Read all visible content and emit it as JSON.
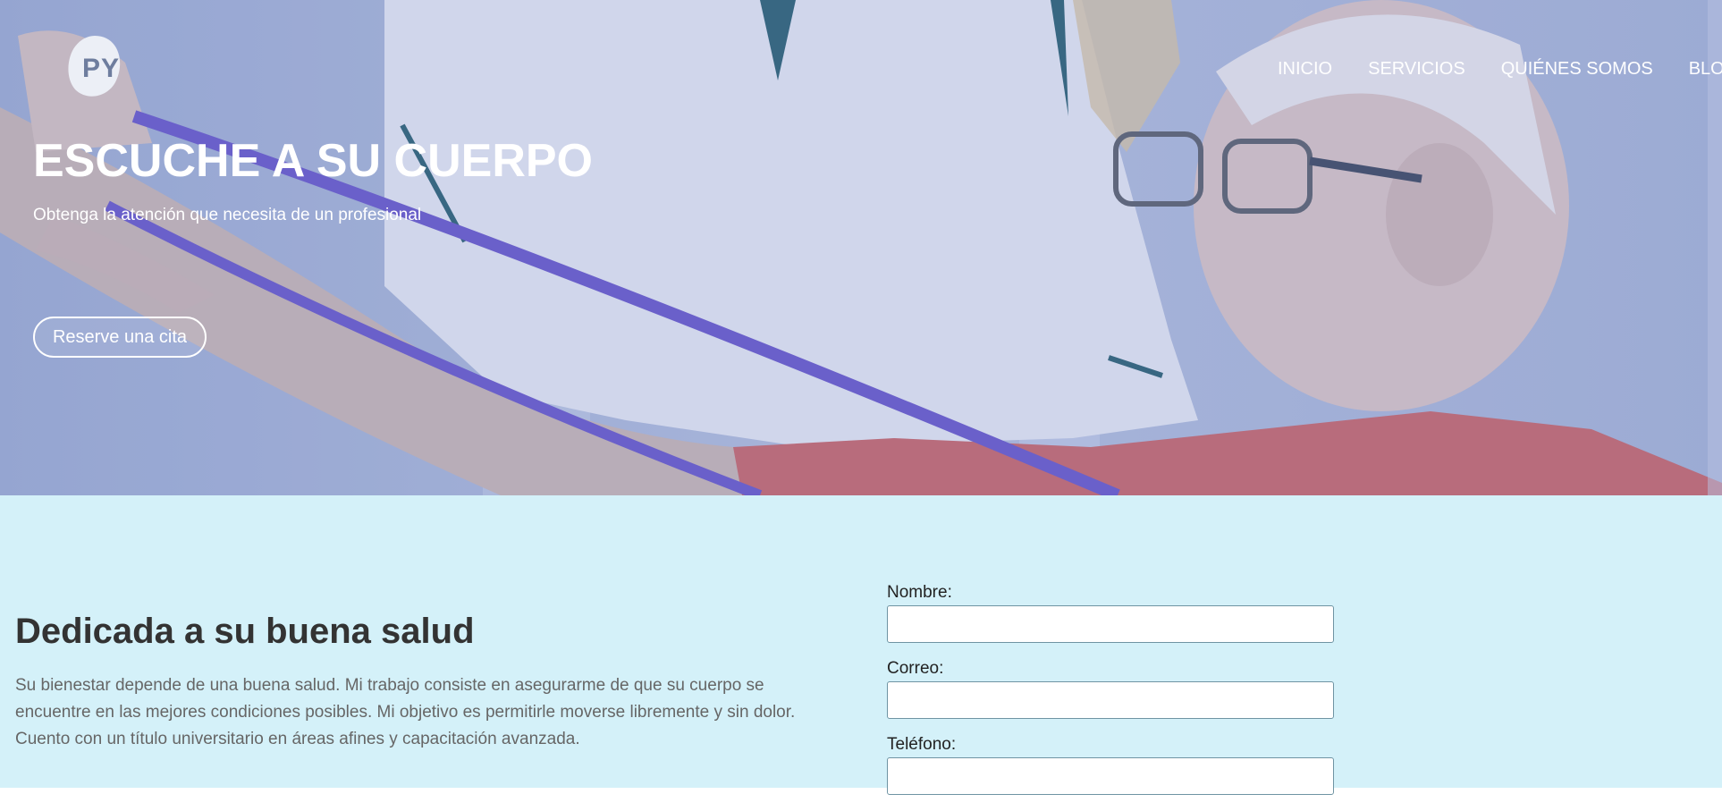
{
  "logo": {
    "text": "PY"
  },
  "nav": {
    "items": [
      "INICIO",
      "SERVICIOS",
      "QUIÉNES SOMOS",
      "BLOG"
    ]
  },
  "hero": {
    "title": "ESCUCHE A SU CUERPO",
    "subtitle": "Obtenga la atención que necesita de un profesional",
    "cta_label": "Reserve una cita"
  },
  "about": {
    "title": "Dedicada a su buena salud",
    "text": "Su bienestar depende de una buena salud. Mi trabajo consiste en asegurarme de que su cuerpo se encuentre en las mejores condiciones posibles. Mi objetivo es permitirle moverse libremente y sin dolor. Cuento con un título universitario en áreas afines y capacitación avanzada."
  },
  "form": {
    "name_label": "Nombre:",
    "name_value": "",
    "email_label": "Correo:",
    "email_value": "",
    "phone_label": "Teléfono:",
    "phone_value": ""
  },
  "colors": {
    "hero_tint": "#a3b1d8",
    "content_bg": "#d4f1f9",
    "band_purple": "#6a5acd",
    "shirt_red": "#c9686e"
  }
}
